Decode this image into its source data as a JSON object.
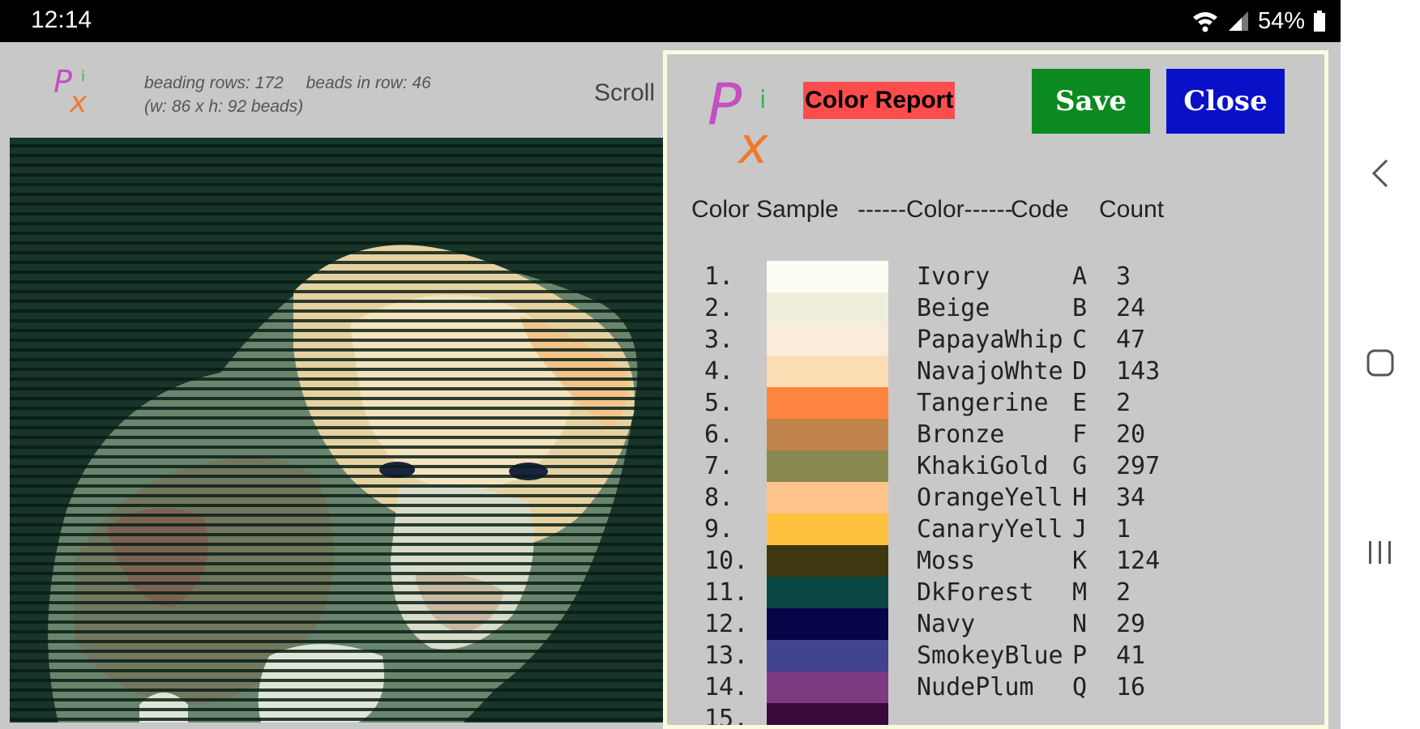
{
  "status_bar": {
    "time": "12:14",
    "battery": "54%",
    "icons": [
      "wifi-icon",
      "signal-icon",
      "battery-icon"
    ]
  },
  "header": {
    "info_line1_a": "beading rows: 172",
    "info_line1_b": "beads in row: 46",
    "info_line2": "(w: 86  x  h: 92 beads)",
    "scroll_label": "Scroll"
  },
  "report": {
    "title": "Color Report",
    "save_label": "Save",
    "close_label": "Close",
    "columns": {
      "sample": "Color Sample",
      "color": "------Color------",
      "code": "Code",
      "count": "Count"
    },
    "rows": [
      {
        "num": "1.",
        "color": "Ivory",
        "code": "A",
        "count": "3",
        "hex": "#fdfdf3"
      },
      {
        "num": "2.",
        "color": "Beige",
        "code": "B",
        "count": "24",
        "hex": "#efeedd"
      },
      {
        "num": "3.",
        "color": "PapayaWhip",
        "code": "C",
        "count": "47",
        "hex": "#f9ecd9"
      },
      {
        "num": "4.",
        "color": "NavajoWhte",
        "code": "D",
        "count": "143",
        "hex": "#fcdcb3"
      },
      {
        "num": "5.",
        "color": "Tangerine",
        "code": "E",
        "count": "2",
        "hex": "#ff8540"
      },
      {
        "num": "6.",
        "color": "Bronze",
        "code": "F",
        "count": "20",
        "hex": "#c0844a"
      },
      {
        "num": "7.",
        "color": "KhakiGold",
        "code": "G",
        "count": "297",
        "hex": "#8a8950"
      },
      {
        "num": "8.",
        "color": "OrangeYell",
        "code": "H",
        "count": "34",
        "hex": "#ffc48c"
      },
      {
        "num": "9.",
        "color": "CanaryYell",
        "code": "J",
        "count": "1",
        "hex": "#ffc23e"
      },
      {
        "num": "10.",
        "color": "Moss",
        "code": "K",
        "count": "124",
        "hex": "#3e3810"
      },
      {
        "num": "11.",
        "color": "DkForest",
        "code": "M",
        "count": "2",
        "hex": "#0a4642"
      },
      {
        "num": "12.",
        "color": "Navy",
        "code": "N",
        "count": "29",
        "hex": "#070447"
      },
      {
        "num": "13.",
        "color": "SmokeyBlue",
        "code": "P",
        "count": "41",
        "hex": "#41438e"
      },
      {
        "num": "14.",
        "color": "NudePlum",
        "code": "Q",
        "count": "16",
        "hex": "#7e3a80"
      },
      {
        "num": "15.",
        "color": "",
        "code": "",
        "count": "",
        "hex": "#3a0a3a"
      }
    ]
  },
  "colors": {
    "save": "#0b8a1f",
    "close": "#0a10c8",
    "title_bg": "#ff4d4d",
    "logo_p": "#c44fc0",
    "logo_x": "#f07a2a",
    "logo_i": "#2db84a"
  }
}
